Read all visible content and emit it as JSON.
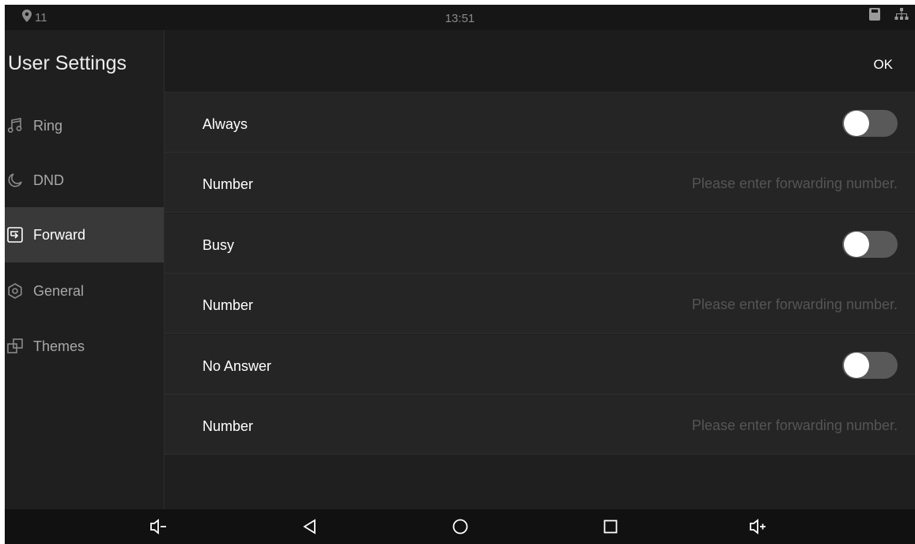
{
  "status_bar": {
    "notification_count": "11",
    "time": "13:51"
  },
  "sidebar": {
    "title": "User Settings",
    "items": [
      {
        "label": "Ring",
        "icon": "music-note-icon",
        "active": false
      },
      {
        "label": "DND",
        "icon": "moon-icon",
        "active": false
      },
      {
        "label": "Forward",
        "icon": "forward-icon",
        "active": true
      },
      {
        "label": "General",
        "icon": "gear-icon",
        "active": false
      },
      {
        "label": "Themes",
        "icon": "themes-icon",
        "active": false
      }
    ]
  },
  "header": {
    "ok_label": "OK"
  },
  "forward": {
    "always": {
      "label": "Always",
      "enabled": false
    },
    "always_number": {
      "label": "Number",
      "value": "",
      "placeholder": "Please enter forwarding number."
    },
    "busy": {
      "label": "Busy",
      "enabled": false
    },
    "busy_number": {
      "label": "Number",
      "value": "",
      "placeholder": "Please enter forwarding number."
    },
    "no_answer": {
      "label": "No Answer",
      "enabled": false
    },
    "no_answer_number": {
      "label": "Number",
      "value": "",
      "placeholder": "Please enter forwarding number."
    }
  },
  "nav_bar": {
    "buttons": [
      "volume-down-icon",
      "back-icon",
      "home-icon",
      "recents-icon",
      "volume-up-icon"
    ]
  },
  "colors": {
    "background": "#1f1f1f",
    "row_background": "#252525",
    "active_nav": "#393939",
    "toggle_off": "#595959",
    "placeholder": "#555555"
  }
}
